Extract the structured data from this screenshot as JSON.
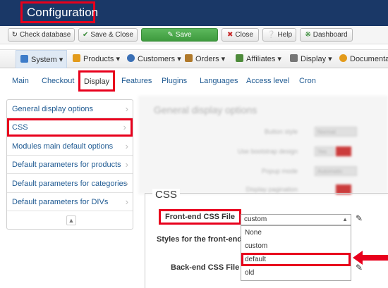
{
  "header": {
    "title": "Configuration"
  },
  "toolbar": {
    "check_database": "Check database",
    "save_close": "Save & Close",
    "save": "Save",
    "close": "Close",
    "help": "Help",
    "dashboard": "Dashboard"
  },
  "menu": {
    "system": "System",
    "products": "Products",
    "customers": "Customers",
    "orders": "Orders",
    "affiliates": "Affiliates",
    "display": "Display",
    "documentation": "Documentat"
  },
  "tabs": {
    "main": "Main",
    "checkout": "Checkout",
    "display": "Display",
    "features": "Features",
    "plugins": "Plugins",
    "languages": "Languages",
    "access_level": "Access level",
    "cron": "Cron"
  },
  "leftlist": {
    "items": [
      "General display options",
      "CSS",
      "Modules main default options",
      "Default parameters for products",
      "Default parameters for categories",
      "Default parameters for DIVs"
    ]
  },
  "blurred": {
    "title": "General display options",
    "rows": [
      "Button style",
      "Use bootstrap design",
      "Popup mode",
      "Display pagination"
    ],
    "values": [
      "Normal",
      "Yes",
      "Automatic"
    ]
  },
  "css": {
    "legend": "CSS",
    "frontend_label": "Front-end CSS File",
    "styles_label": "Styles for the front-end",
    "backend_label": "Back-end CSS File",
    "select_value": "custom",
    "options": [
      "None",
      "custom",
      "default",
      "old"
    ]
  },
  "colors": {
    "header_bg": "#1a3867",
    "highlight": "#e8001c",
    "save_green": "#4cae4c",
    "link_blue": "#1f5a92"
  }
}
